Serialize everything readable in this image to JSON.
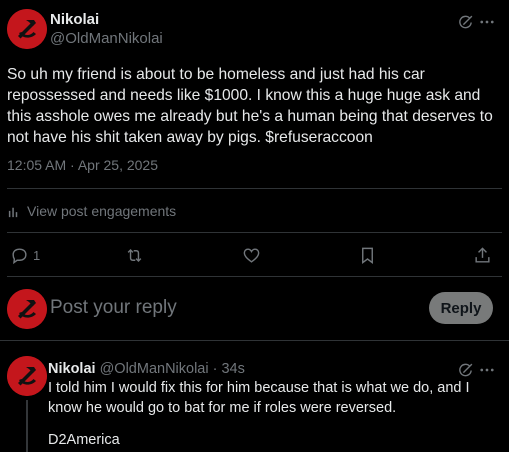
{
  "post": {
    "author_name": "Nikolai",
    "author_handle": "@OldManNikolai",
    "text": "So uh my friend is about to be homeless and just had his car repossessed and needs like $1000. I know this a huge huge ask and this asshole owes me already but he's a human being that deserves to not have his shit taken away by pigs. $refuseraccoon",
    "timestamp": "12:05 AM · Apr 25, 2025",
    "engagements_label": "View post engagements",
    "reply_count": "1",
    "icons": [
      "grok-icon",
      "more-icon",
      "reply-icon",
      "repost-icon",
      "like-icon",
      "bookmark-icon",
      "share-icon",
      "analytics-icon"
    ]
  },
  "composer": {
    "placeholder": "Post your reply",
    "button_label": "Reply"
  },
  "reply": {
    "author_name": "Nikolai",
    "author_handle": "@OldManNikolai",
    "time": "· 34s",
    "line1": "I told him I would fix this for him because that is what we do, and I know he would go to bat for me if roles were reversed.",
    "line2": "D2America"
  },
  "colors": {
    "background": "#000000",
    "text": "#e7e9ea",
    "muted": "#71767b",
    "avatar": "#c4161c",
    "reply_button": "#787a7a"
  }
}
